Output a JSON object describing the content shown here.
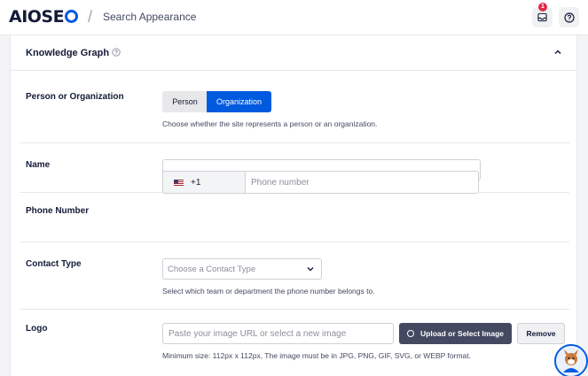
{
  "header": {
    "logo_prefix": "AIOSE",
    "logo_suffix": "",
    "page_title": "Search Appearance",
    "notification_count": "1"
  },
  "card": {
    "title": "Knowledge Graph"
  },
  "person_or_org": {
    "label": "Person or Organization",
    "options": [
      "Person",
      "Organization"
    ],
    "selected": "Organization",
    "help": "Choose whether the site represents a person or an organization."
  },
  "name": {
    "label": "Name",
    "value": ""
  },
  "phone": {
    "label": "Phone Number",
    "country_code": "+1",
    "placeholder": "Phone number"
  },
  "contact_type": {
    "label": "Contact Type",
    "placeholder": "Choose a Contact Type",
    "help": "Select which team or department the phone number belongs to."
  },
  "logo": {
    "label": "Logo",
    "placeholder": "Paste your image URL or select a new image",
    "upload_label": "Upload or Select Image",
    "remove_label": "Remove",
    "help": "Minimum size: 112px x 112px, The image must be in JPG, PNG, GIF, SVG, or WEBP format."
  },
  "colors": {
    "brand": "#005ae0",
    "text": "#141b38",
    "badge": "#df2a4a"
  }
}
